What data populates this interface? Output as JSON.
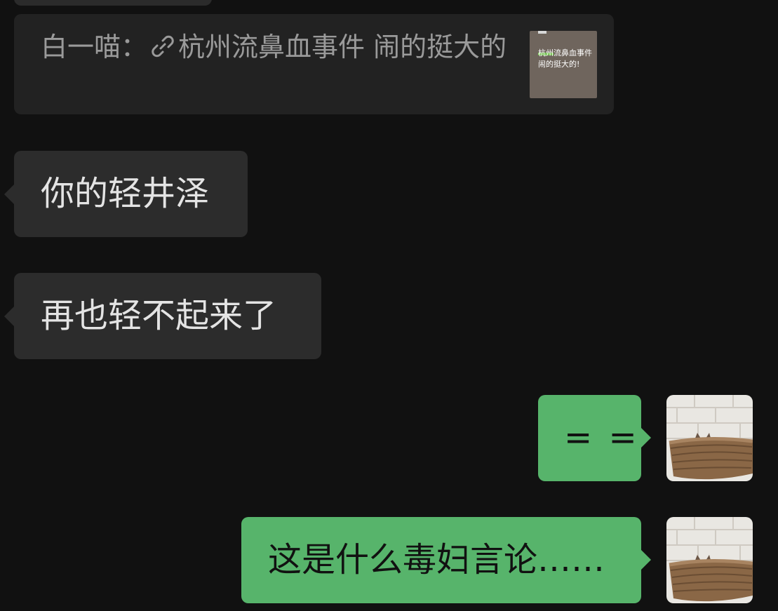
{
  "chat": {
    "quote": {
      "sender": "白一喵",
      "separator": "：",
      "title": "杭州流鼻血事件 闹的挺大的",
      "icon": "link-icon",
      "thumbnail": {
        "caption": "杭州流鼻血事件\n闹的挺大的!",
        "bg_color": "#6f655d"
      }
    },
    "messages": [
      {
        "direction": "incoming",
        "text": "你的轻井泽"
      },
      {
        "direction": "incoming",
        "text": "再也轻不起来了"
      },
      {
        "direction": "outgoing",
        "text": "= ="
      },
      {
        "direction": "outgoing",
        "text": "这是什么毒妇言论……"
      }
    ],
    "self_avatar": "cat-in-basket-avatar"
  },
  "colors": {
    "background": "#111111",
    "incoming_bubble": "#2c2c2c",
    "outgoing_bubble": "#57b46b",
    "quote_card": "#222222"
  }
}
